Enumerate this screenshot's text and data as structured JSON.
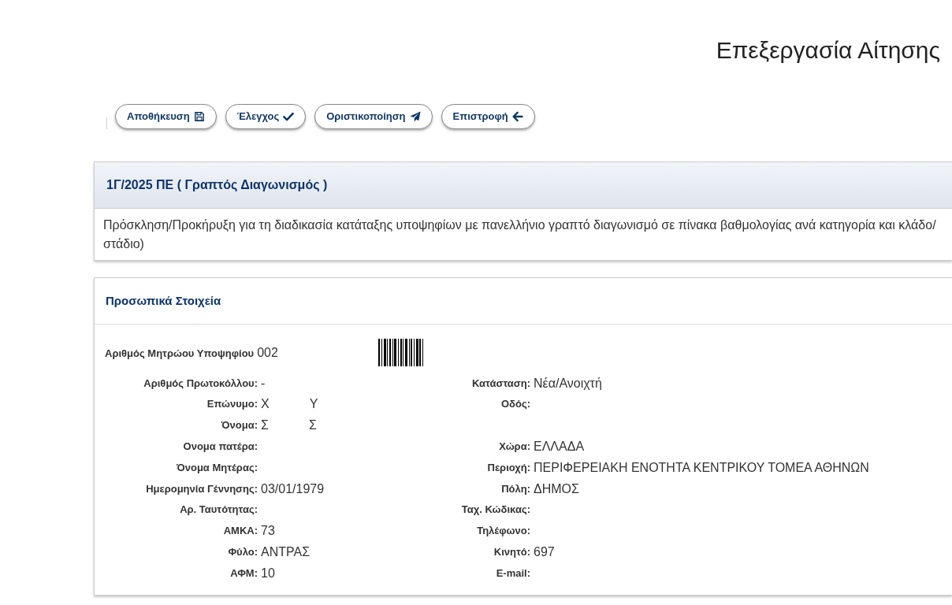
{
  "page_title": "Επεξεργασία Αίτησης",
  "toolbar": {
    "buttons": [
      {
        "label": "Αποθήκευση",
        "kind": "save"
      },
      {
        "label": "Έλεγχος",
        "kind": "check"
      },
      {
        "label": "Οριστικοποίηση",
        "kind": "submit"
      },
      {
        "label": "Επιστροφή",
        "kind": "back"
      }
    ]
  },
  "call_panel": {
    "title": "1Γ/2025 ΠΕ ( Γραπτός Διαγωνισμός )",
    "description_lines": [
      "Πρόσκληση/Προκήρυξη για τη διαδικασία κατάταξης υποψηφίων με πανελλήνιο γραπτό διαγωνισμό σε πίνακα βαθμολογίας ανά κατηγορία και κλάδο/",
      "στάδιο)"
    ]
  },
  "personal_panel": {
    "title": "Προσωπικά Στοιχεία",
    "registry": {
      "label": "Αριθμός Μητρώου Υποψηφίου",
      "value": "002"
    },
    "rows": [
      {
        "left": {
          "label": "Αριθμός Πρωτοκόλλου:",
          "value": "-"
        },
        "right": {
          "label": "Κατάσταση:",
          "value": "Νέα/Ανοιχτή"
        }
      },
      {
        "left": {
          "label": "Επώνυμο:",
          "value_parts": [
            "Χ",
            "Υ"
          ]
        },
        "right": {
          "label": "Οδός:"
        }
      },
      {
        "left": {
          "label": "Όνομα:",
          "value_parts": [
            "Σ",
            "Σ"
          ]
        }
      },
      {
        "left": {
          "label": "Ονομα πατέρα:"
        },
        "right": {
          "label": "Χώρα:",
          "value": "ΕΛΛΑΔΑ"
        }
      },
      {
        "left": {
          "label": "Όνομα Μητέρας:"
        },
        "right": {
          "label": "Περιοχή:",
          "value": "ΠΕΡΙΦΕΡΕΙΑΚΗ ΕΝΟΤΗΤΑ ΚΕΝΤΡΙΚΟΥ ΤΟΜΕΑ ΑΘΗΝΩΝ"
        }
      },
      {
        "left": {
          "label": "Ημερομηνία Γέννησης:",
          "value": "03/01/1979"
        },
        "right": {
          "label": "Πόλη:",
          "value": "ΔΗΜΟΣ"
        }
      },
      {
        "left": {
          "label": "Αρ. Ταυτότητας:"
        },
        "right": {
          "label": "Ταχ. Κώδικας:"
        }
      },
      {
        "left": {
          "label": "ΑΜΚΑ:",
          "value": "73"
        },
        "right": {
          "label": "Τηλέφωνο:"
        }
      },
      {
        "left": {
          "label": "Φύλο:",
          "value": "ΑΝΤΡΑΣ"
        },
        "right": {
          "label": "Κινητό:",
          "value": "697"
        }
      },
      {
        "left": {
          "label": "ΑΦΜ:",
          "value": "10"
        },
        "right": {
          "label": "E-mail:"
        }
      }
    ]
  }
}
